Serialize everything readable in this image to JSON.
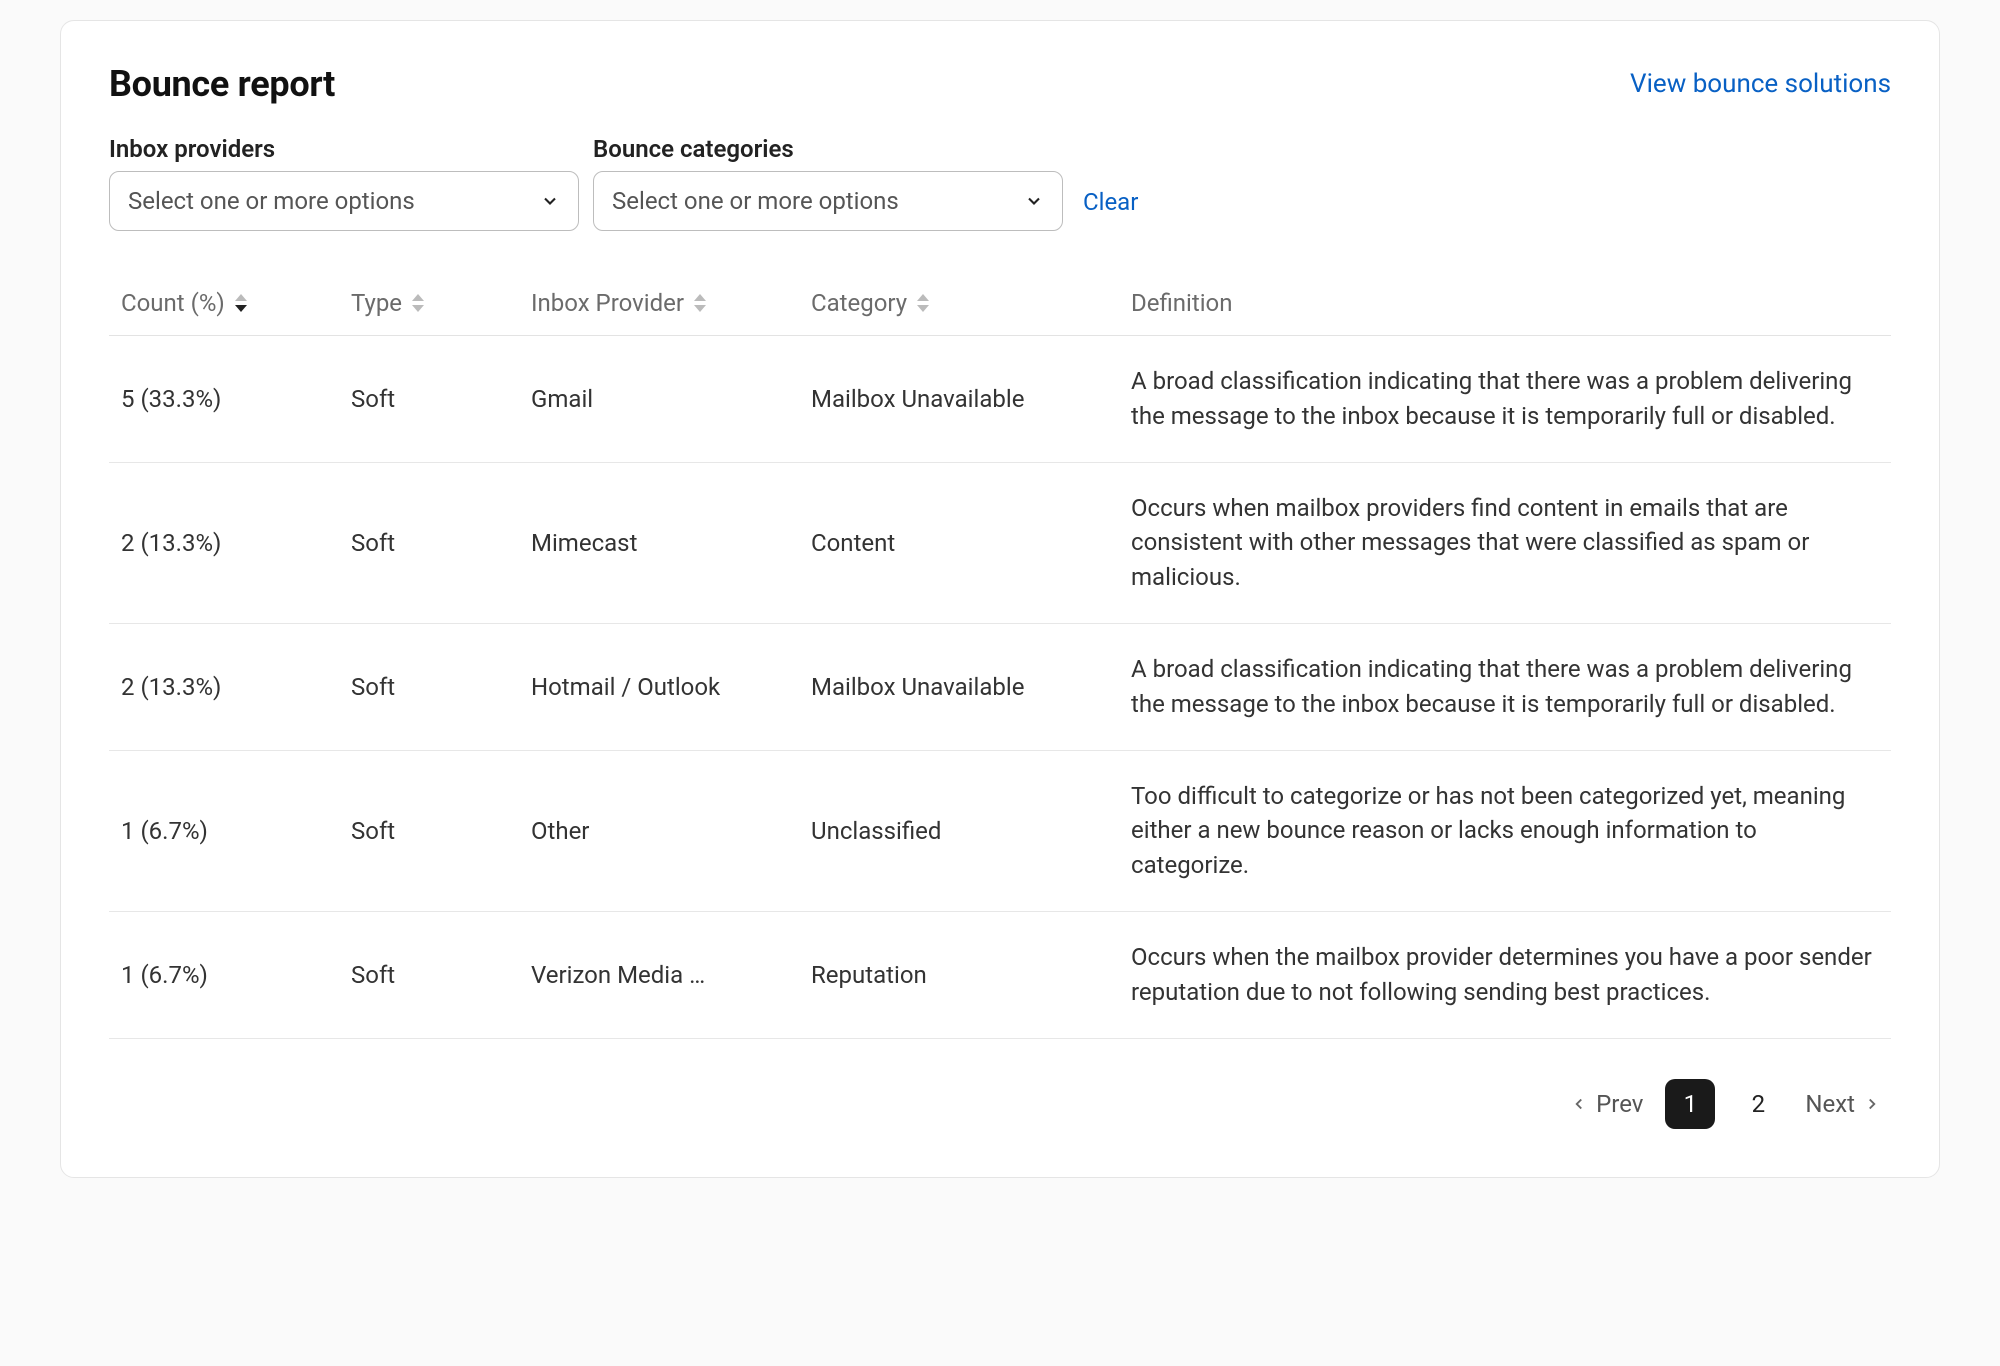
{
  "title": "Bounce report",
  "view_solutions": "View bounce solutions",
  "filters": {
    "inbox_providers": {
      "label": "Inbox providers",
      "placeholder": "Select one or more options"
    },
    "bounce_categories": {
      "label": "Bounce categories",
      "placeholder": "Select one or more options"
    },
    "clear": "Clear"
  },
  "table": {
    "headers": {
      "count": "Count (%)",
      "type": "Type",
      "provider": "Inbox Provider",
      "category": "Category",
      "definition": "Definition"
    },
    "sort": {
      "column": "count",
      "direction": "desc"
    },
    "rows": [
      {
        "count": "5 (33.3%)",
        "type": "Soft",
        "provider": "Gmail",
        "category": "Mailbox Unavailable",
        "definition": "A broad classification indicating that there was a problem delivering the message to the inbox because it is temporarily full or disabled."
      },
      {
        "count": "2 (13.3%)",
        "type": "Soft",
        "provider": "Mimecast",
        "category": "Content",
        "definition": "Occurs when mailbox providers find content in emails that are consistent with other messages that were classified as spam or malicious."
      },
      {
        "count": "2 (13.3%)",
        "type": "Soft",
        "provider": "Hotmail / Outlook",
        "category": "Mailbox Unavailable",
        "definition": "A broad classification indicating that there was a problem delivering the message to the inbox because it is temporarily full or disabled."
      },
      {
        "count": "1 (6.7%)",
        "type": "Soft",
        "provider": "Other",
        "category": "Unclassified",
        "definition": "Too difficult to categorize or has not been categorized yet, meaning either a new bounce reason or lacks enough information to categorize."
      },
      {
        "count": "1 (6.7%)",
        "type": "Soft",
        "provider": "Verizon Media …",
        "category": "Reputation",
        "definition": "Occurs when the mailbox provider determines you have a poor sender reputation due to not following sending best practices."
      }
    ]
  },
  "pagination": {
    "prev": "Prev",
    "next": "Next",
    "pages": [
      "1",
      "2"
    ],
    "current": "1"
  }
}
